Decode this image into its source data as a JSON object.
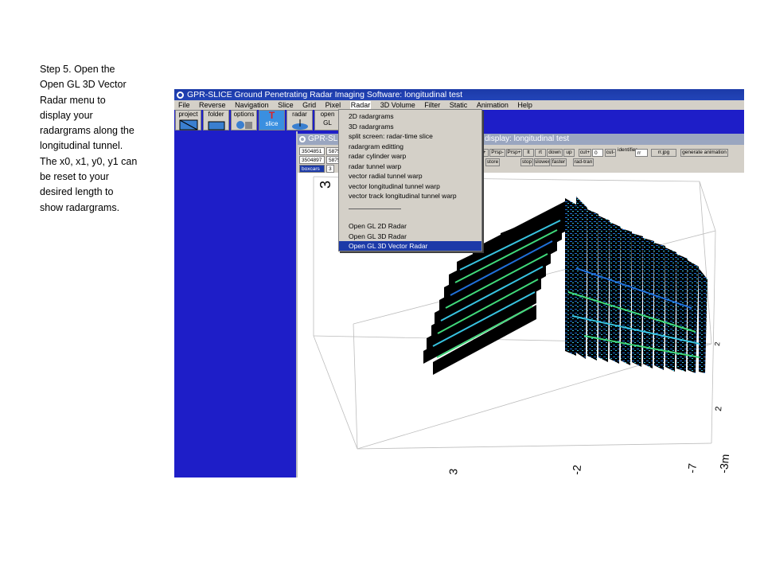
{
  "caption": {
    "lines": [
      "Step 5.  Open the",
      "Open GL 3D Vector",
      "Radar menu to",
      "display your",
      "radargrams along the",
      "longitudinal tunnel.",
      "The x0, x1, y0, y1 can",
      "be reset to your",
      "desired length to",
      "show radargrams."
    ]
  },
  "app": {
    "title": "GPR-SLICE    Ground Penetrating Radar Imaging Software:   longitudinal test",
    "menu": [
      "File",
      "Reverse",
      "Navigation",
      "Slice",
      "Grid",
      "Pixel",
      "Radar",
      "3D Volume",
      "Filter",
      "Static",
      "Animation",
      "Help"
    ],
    "active_menu": "Radar",
    "toolbar": [
      {
        "label": "project",
        "icon": "project-icon"
      },
      {
        "label": "folder",
        "icon": "folder-icon"
      },
      {
        "label": "options",
        "icon": "options-icon"
      },
      {
        "label": "T",
        "sub": "slice",
        "icon": "slice-icon"
      },
      {
        "label": "radar",
        "icon": "radar-icon"
      },
      {
        "label": "open",
        "sub": "GL",
        "icon": "gl-icon"
      }
    ]
  },
  "subwindow": {
    "title_left": "GPR-SLI",
    "title_right": "display:    longitudinal test",
    "fields": {
      "v1": "3504851",
      "v2": "5875",
      "v3": "3504897",
      "v4": "5875",
      "v5": "boxcars",
      "v6": "3",
      "cut_value": "0",
      "identifier": "rr",
      "jpg": "rr.jpg"
    },
    "buttons_row1": [
      "c+",
      "Prsp-",
      "Prsp+",
      "lt",
      "rt",
      "down",
      "up",
      "cut+",
      "cut-",
      "generate animation"
    ],
    "identifier_label": "identifier",
    "buttons_row2": [
      "store",
      "stop",
      "slower",
      "faster",
      "rad-tran"
    ]
  },
  "radar_menu": {
    "items": [
      "2D radargrams",
      "3D radargrams",
      "split screen: radar-time slice",
      "radargram editting",
      "radar cylinder warp",
      "radar tunnel warp",
      "vector radial tunnel warp",
      "vector longitudinal tunnel warp",
      "vector track longitudinal tunnel warp",
      "Open GL 2D Radar",
      "Open GL 3D Radar",
      "Open GL 3D Vector Radar"
    ],
    "selected": "Open GL 3D Vector Radar"
  },
  "plot": {
    "axis_labels": [
      "3",
      "-2",
      "-7",
      "-3m",
      "2",
      "2",
      "3"
    ],
    "colors": {
      "slice": "#000000",
      "signal_green": "#3fd97a",
      "signal_cyan": "#37c3e0",
      "signal_blue": "#1f6fd8"
    }
  }
}
